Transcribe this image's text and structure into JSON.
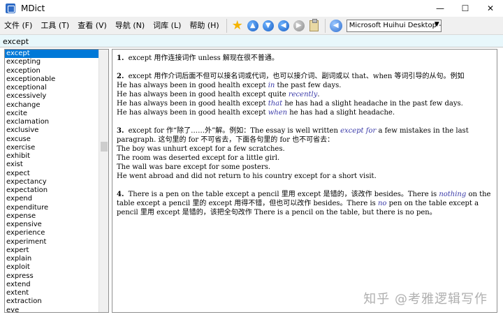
{
  "window": {
    "title": "MDict",
    "minimize": "—",
    "maximize": "☐",
    "close": "✕"
  },
  "menu": [
    {
      "label": "文件 (F)"
    },
    {
      "label": "工具 (T)"
    },
    {
      "label": "查看 (V)"
    },
    {
      "label": "导航 (N)"
    },
    {
      "label": "词库 (L)"
    },
    {
      "label": "帮助 (H)"
    }
  ],
  "toolbar": {
    "voice": "Microsoft Huihui Desktop - C",
    "icons": [
      "star-icon",
      "back-icon",
      "forward-icon",
      "previous-icon",
      "next-icon",
      "clipboard-icon",
      "speaker-icon"
    ]
  },
  "search": {
    "value": "except"
  },
  "wordlist": {
    "selected": "except",
    "items": [
      "except",
      "excepting",
      "exception",
      "exceptionable",
      "exceptional",
      "excessively",
      "exchange",
      "excite",
      "exclamation",
      "exclusive",
      "excuse",
      "exercise",
      "exhibit",
      "exist",
      "expect",
      "expectancy",
      "expectation",
      "expend",
      "expenditure",
      "expense",
      "expensive",
      "experience",
      "experiment",
      "expert",
      "explain",
      "exploit",
      "express",
      "extend",
      "extent",
      "extraction",
      "eye"
    ]
  },
  "entries": [
    {
      "num": "1.",
      "text": "except 用作连接词作 unless 解现在很不普通。"
    },
    {
      "num": "2.",
      "text": "except 用作介词后面不但可以接名词或代词，也可以接介词、副词或以 that、when 等词引导的从句。例如",
      "examples": [
        {
          "pre": "He has always been in good health except ",
          "em": "in",
          "post": " the past few days."
        },
        {
          "pre": "He has always been in good health except quite ",
          "em": "recently",
          "post": "."
        },
        {
          "pre": "He has always been in good health except ",
          "em": "that",
          "post": " he has had a slight headache in the past few days."
        },
        {
          "pre": "He has always been in good health except ",
          "em": "when",
          "post": " he has had a slight headache."
        }
      ]
    },
    {
      "num": "3.",
      "pre": "except for 作“除了……外”解。例如：The essay is well written ",
      "em": "except for",
      "post": " a few mistakes in the last paragraph. 这句里的 for 不可省去，下面各句里的 for 也不可省去：",
      "plain": [
        "The boy was unhurt except for a few scratches.",
        "The room was deserted except for a little girl.",
        "The wall was bare except for some posters.",
        "He went abroad and did not return to his country except for a short visit."
      ]
    },
    {
      "num": "4.",
      "p1": "There is a pen on the table except a pencil 里用 except 是错的，该改作 besides。There is ",
      "em1": "nothing",
      "p2": " on the table except a pencil 里的 except 用得不错，但也可以改作 besides。There is ",
      "em2": "no",
      "p3": " pen on the table except a pencil 里用 except 是错的，该把全句改作 There is a pencil on the table, but there is no pen。"
    }
  ],
  "watermark": "知乎 @考雅逻辑写作"
}
